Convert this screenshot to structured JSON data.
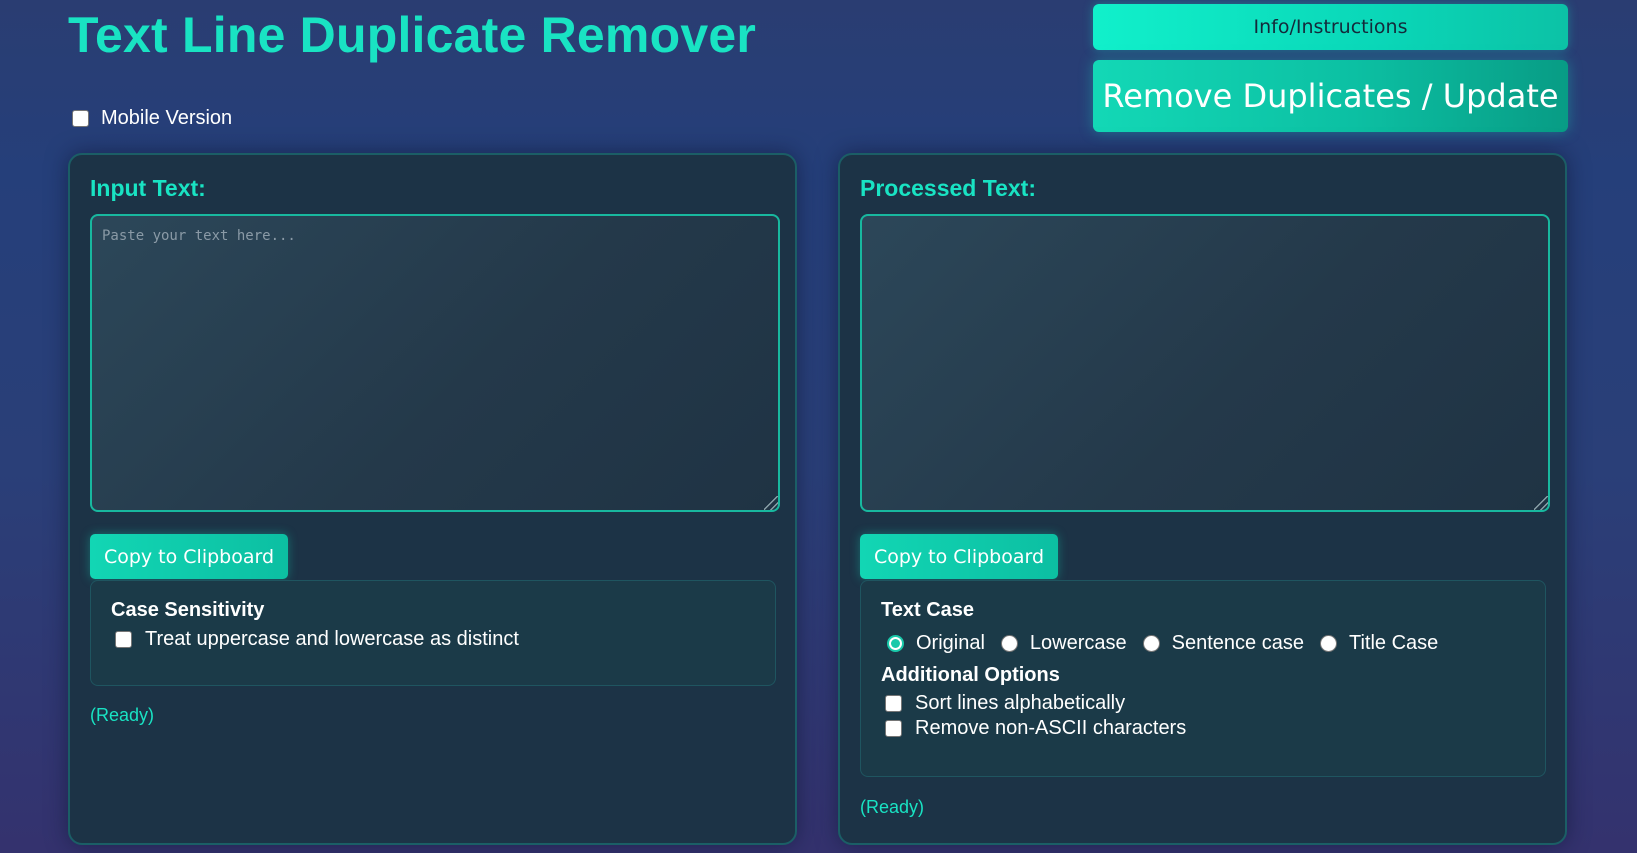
{
  "header": {
    "title": "Text Line Duplicate Remover",
    "mobile_label": "Mobile Version",
    "mobile_checked": false,
    "info_label": "Info/Instructions",
    "remove_label": "Remove Duplicates / Update"
  },
  "input_panel": {
    "label": "Input Text:",
    "placeholder": "Paste your text here...",
    "value": "",
    "copy_label": "Copy to Clipboard",
    "case_heading": "Case Sensitivity",
    "case_option": "Treat uppercase and lowercase as distinct",
    "case_checked": false,
    "status": "(Ready)"
  },
  "output_panel": {
    "label": "Processed Text:",
    "value": "",
    "copy_label": "Copy to Clipboard",
    "text_case_heading": "Text Case",
    "text_case_options": [
      "Original",
      "Lowercase",
      "Sentence case",
      "Title Case"
    ],
    "text_case_selected": "Original",
    "additional_heading": "Additional Options",
    "sort_label": "Sort lines alphabetically",
    "sort_checked": false,
    "ascii_label": "Remove non-ASCII characters",
    "ascii_checked": false,
    "status": "(Ready)"
  },
  "colors": {
    "accent": "#19e3c3",
    "panel_bg": "#1c3346",
    "background_top": "#2a3d72",
    "background_bottom": "#34326e"
  }
}
